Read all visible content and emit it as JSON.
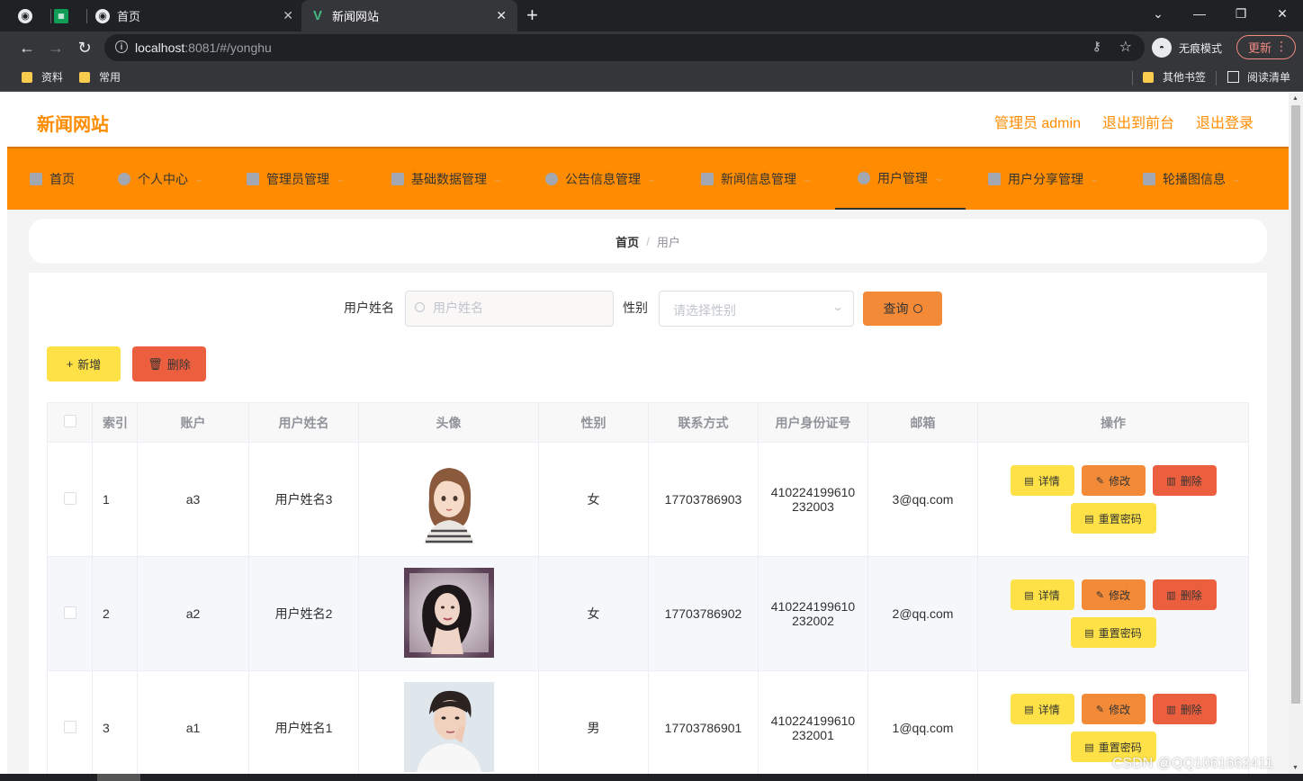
{
  "browser": {
    "tabs": [
      {
        "label": ""
      },
      {
        "label": ""
      },
      {
        "label": "首页"
      },
      {
        "label": "新闻网站"
      }
    ],
    "url_host": "localhost",
    "url_rest": ":8081/#/yonghu",
    "incognito_label": "无痕模式",
    "update_label": "更新",
    "bookmarks": [
      "资料",
      "常用"
    ],
    "other_bookmarks": "其他书签",
    "reading_list": "阅读清单"
  },
  "site": {
    "title": "新闻网站",
    "header_links": [
      "管理员 admin",
      "退出到前台",
      "退出登录"
    ]
  },
  "nav": [
    {
      "label": "首页",
      "icon": "home-icon",
      "dropdown": false
    },
    {
      "label": "个人中心",
      "icon": "user-icon",
      "dropdown": true
    },
    {
      "label": "管理员管理",
      "icon": "mail-icon",
      "dropdown": true
    },
    {
      "label": "基础数据管理",
      "icon": "data-icon",
      "dropdown": true
    },
    {
      "label": "公告信息管理",
      "icon": "notice-icon",
      "dropdown": true
    },
    {
      "label": "新闻信息管理",
      "icon": "news-icon",
      "dropdown": true
    },
    {
      "label": "用户管理",
      "icon": "power-icon",
      "dropdown": true,
      "active": true
    },
    {
      "label": "用户分享管理",
      "icon": "share-icon",
      "dropdown": true
    },
    {
      "label": "轮播图信息",
      "icon": "image-icon",
      "dropdown": true
    }
  ],
  "breadcrumb": {
    "home": "首页",
    "sep": "/",
    "current": "用户"
  },
  "search": {
    "name_label": "用户姓名",
    "name_placeholder": "用户姓名",
    "gender_label": "性别",
    "gender_placeholder": "请选择性别",
    "query_label": "查询"
  },
  "actions": {
    "add_label": "新增",
    "delete_label": "删除"
  },
  "table": {
    "headers": [
      "索引",
      "账户",
      "用户姓名",
      "头像",
      "性别",
      "联系方式",
      "用户身份证号",
      "邮箱",
      "操作"
    ],
    "rows": [
      {
        "index": "1",
        "account": "a3",
        "name": "用户姓名3",
        "gender": "女",
        "phone": "17703786903",
        "id_line1": "410224199610",
        "id_line2": "232003",
        "email": "3@qq.com"
      },
      {
        "index": "2",
        "account": "a2",
        "name": "用户姓名2",
        "gender": "女",
        "phone": "17703786902",
        "id_line1": "410224199610",
        "id_line2": "232002",
        "email": "2@qq.com"
      },
      {
        "index": "3",
        "account": "a1",
        "name": "用户姓名1",
        "gender": "男",
        "phone": "17703786901",
        "id_line1": "410224199610",
        "id_line2": "232001",
        "email": "1@qq.com"
      }
    ],
    "op_labels": {
      "detail": "详情",
      "edit": "修改",
      "remove": "删除",
      "reset": "重置密码"
    }
  },
  "watermark": "CSDN @QQ1061662411",
  "colors": {
    "accent": "#ff8c00",
    "yellow": "#fde146",
    "orange": "#f28a38",
    "red": "#ec5f3e"
  }
}
